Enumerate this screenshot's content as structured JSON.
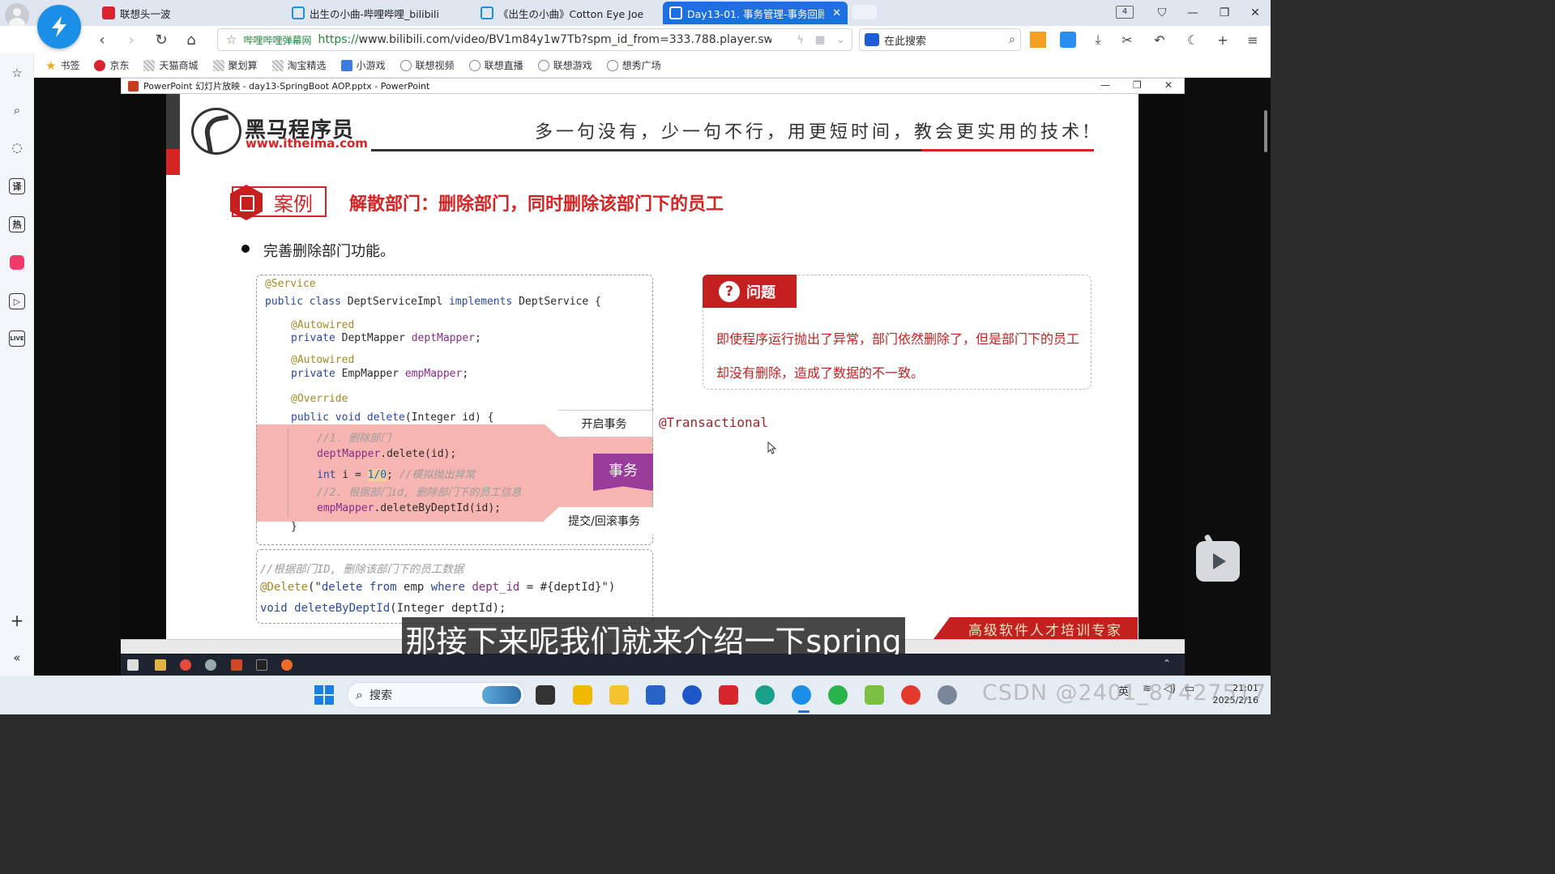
{
  "browser": {
    "tabs": [
      {
        "label": "联想头一波",
        "active": false
      },
      {
        "label": "出生の小曲-哔哩哔哩_bilibili",
        "active": false
      },
      {
        "label": "《出生の小曲》Cotton Eye Joe",
        "active": false
      },
      {
        "label": "Day13-01. 事务管理-事务回顾",
        "active": true
      }
    ],
    "tab_count": "4",
    "address": {
      "site_label": "哔哩哔哩弹幕网",
      "url_scheme": "https://",
      "url_rest": "www.bilibili.com/video/BV1m84y1w7Tb?spm_id_from=333.788.player.switc"
    },
    "search_placeholder": "在此搜索",
    "bookmarks": [
      "书签",
      "京东",
      "天猫商城",
      "聚划算",
      "淘宝精选",
      "小游戏",
      "联想视频",
      "联想直播",
      "联想游戏",
      "想秀广场"
    ]
  },
  "ppt_window": {
    "title": "PowerPoint 幻灯片放映 - day13-SpringBoot AOP.pptx - PowerPoint"
  },
  "slide": {
    "logo_cn": "黑马程序员",
    "logo_url": "www.itheima.com",
    "slogan": "多一句没有，少一句不行，用更短时间，教会更实用的技术!",
    "case_label": "案例",
    "case_title": "解散部门：删除部门，同时删除该部门下的员工",
    "bullet": "完善删除部门功能。",
    "code": {
      "l1": "@Service",
      "l2_kw1": "public class",
      "l2_cls": " DeptServiceImpl ",
      "l2_kw2": "implements",
      "l2_iface": " DeptService {",
      "l3": "@Autowired",
      "l4_kw": "private",
      "l4_type": " DeptMapper ",
      "l4_field": "deptMapper",
      "l4_end": ";",
      "l5": "@Autowired",
      "l6_kw": "private",
      "l6_type": " EmpMapper ",
      "l6_field": "empMapper",
      "l6_end": ";",
      "l7": "@Override",
      "l8_kw": "public void",
      "l8_name": " delete",
      "l8_rest": "(Integer id) {",
      "l9": "//1. 删除部门",
      "l10_field": "deptMapper",
      "l10_rest": ".delete(id);",
      "l11_kw": "int",
      "l11_mid": " i = ",
      "l11_expr": "1/0",
      "l11_semi": "; ",
      "l11_cm": "//模拟抛出异常",
      "l12": "//2. 根据部门id, 删除部门下的员工信息",
      "l13_field": "empMapper",
      "l13_rest": ".deleteByDeptId(id);",
      "l14": "}"
    },
    "code2": {
      "l1": "//根据部门ID, 删除该部门下的员工数据",
      "l2_ann": "@Delete",
      "l2_open": "(\"",
      "l2_sql1": "delete from",
      "l2_sql2": " emp ",
      "l2_sql3": "where",
      "l2_sql4": " dept_id",
      "l2_sql5": " = #{deptId}",
      "l2_close": "\")",
      "l3_kw": "void",
      "l3_name": " deleteByDeptId",
      "l3_rest": "(Integer deptId);"
    },
    "open_tx": "开启事务",
    "tx": "事务",
    "commit_tx": "提交/回滚事务",
    "annotation": "@Transactional",
    "problem_label": "问题",
    "problem_text": "即使程序运行抛出了异常，部门依然删除了，但是部门下的员工却没有删除，造成了数据的不一致。",
    "footer": "高级软件人才培训专家"
  },
  "video": {
    "subtitle": "那接下来呢我们就来介绍一下spring"
  },
  "taskbar": {
    "search_label": "搜索",
    "lang": "英",
    "time": "21:01",
    "date": "2025/2/16"
  },
  "watermark": "CSDN @2401_87427517",
  "colors": {
    "accent_red": "#c42020",
    "tab_blue": "#1e6fe0",
    "tx_band": "#f6b5b0",
    "tx_flag": "#9a3d9a"
  }
}
